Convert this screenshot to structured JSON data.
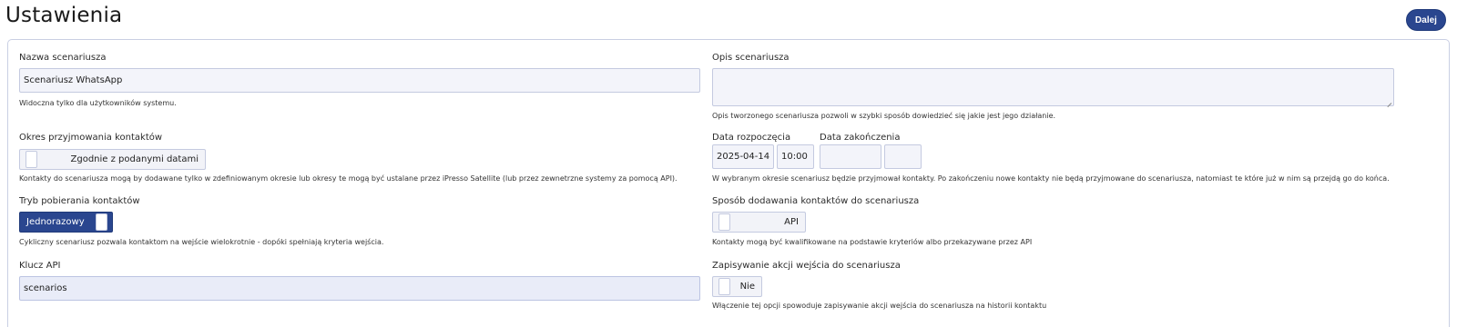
{
  "header": {
    "title": "Ustawienia",
    "next_label": "Dalej"
  },
  "left": {
    "scenario_name": {
      "label": "Nazwa scenariusza",
      "value": "Scenariusz WhatsApp",
      "hint": "Widoczna tylko dla użytkowników systemu."
    },
    "period": {
      "label": "Okres przyjmowania kontaktów",
      "toggle_label": "Zgodnie z podanymi datami",
      "hint": "Kontakty do scenariusza mogą by dodawane tylko w zdefiniowanym okresie lub okresy te mogą być ustalane przez iPresso Satellite (lub przez zewnetrzne systemy za pomocą API)."
    },
    "mode": {
      "label": "Tryb pobierania kontaktów",
      "toggle_label": "Jednorazowy",
      "hint": "Cykliczny scenariusz pozwala kontaktom na wejście wielokrotnie - dopóki spełniają kryteria wejścia."
    },
    "api_key": {
      "label": "Klucz API",
      "value": "scenarios"
    }
  },
  "right": {
    "description": {
      "label": "Opis scenariusza",
      "value": "",
      "hint": "Opis tworzonego scenariusza pozwoli w szybki sposób dowiedzieć się jakie jest jego działanie."
    },
    "dates": {
      "start_label": "Data rozpoczęcia",
      "start_date": "2025-04-14",
      "start_time": "10:00",
      "end_label": "Data zakończenia",
      "end_date": "",
      "end_time": "",
      "hint": "W wybranym okresie scenariusz będzie przyjmował kontakty. Po zakończeniu nowe kontakty nie będą przyjmowane do scenariusza, natomiast te które już w nim są przejdą go do końca."
    },
    "add_method": {
      "label": "Sposób dodawania kontaktów do scenariusza",
      "toggle_label": "API",
      "hint": "Kontakty mogą być kwalifikowane na podstawie kryteriów albo przekazywane przez API"
    },
    "save_action": {
      "label": "Zapisywanie akcji wejścia do scenariusza",
      "toggle_label": "Nie",
      "hint": "Włączenie tej opcji spowoduje zapisywanie akcji wejścia do scenariusza na historii kontaktu"
    }
  },
  "colors": {
    "accent": "#2a468f",
    "panel_border": "#c9cfe3",
    "input_bg": "#f3f4fa"
  }
}
